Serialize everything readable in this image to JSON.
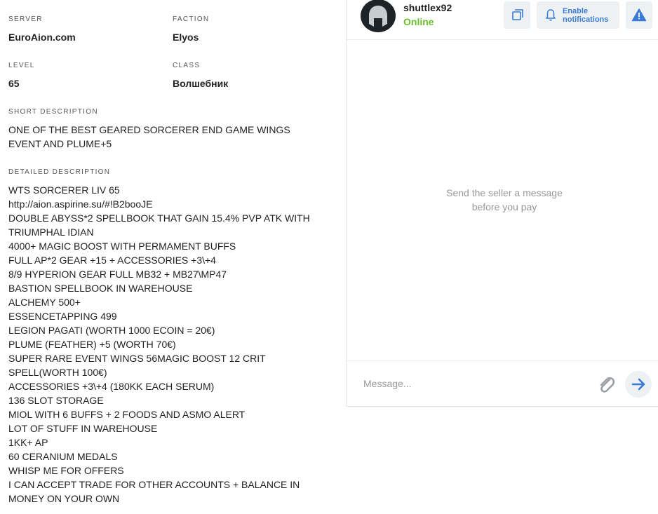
{
  "listing": {
    "server": {
      "label": "SERVER",
      "value": "EuroAion.com"
    },
    "faction": {
      "label": "FACTION",
      "value": "Elyos"
    },
    "level": {
      "label": "LEVEL",
      "value": "65"
    },
    "class": {
      "label": "CLASS",
      "value": "Волшебник"
    },
    "short_description": {
      "label": "SHORT DESCRIPTION",
      "lines": [
        "ONE OF THE BEST GEARED SORCERER END GAME WINGS",
        "EVENT AND PLUME+5"
      ]
    },
    "detailed_description": {
      "label": "DETAILED DESCRIPTION",
      "lines": [
        "WTS SORCERER LIV 65",
        "http://aion.aspirine.su/#!B2booJE",
        "DOUBLE ABYSS*2 SPELLBOOK THAT GAIN 15.4% PVP ATK WITH",
        "TRIUMPHAL IDIAN",
        "4000+ MAGIC BOOST WITH PERMAMENT BUFFS",
        "FULL AP*2 GEAR +15 + ACCESSORIES +3\\+4",
        "8/9 HYPERION GEAR FULL MB32 + MB27\\MP47",
        "BASTION SPELLBOOK IN WAREHOUSE",
        "ALCHEMY 500+",
        "ESSENCETAPPING 499",
        "LEGION PAGATI (WORTH 1000 ECOIN = 20€)",
        "PLUME (FEATHER) +5 (WORTH 70€)",
        "SUPER RARE EVENT WINGS 56MAGIC BOOST 12 CRIT",
        "SPELL(WORTH 100€)",
        "ACCESSORIES +3\\+4 (180KK EACH SERUM)",
        "136 SLOT STORAGE",
        "MIOL WITH 6 BUFFS + 2 FOODS AND ASMO ALERT",
        "LOT OF STUFF IN WAREHOUSE",
        "1KK+ AP",
        "60 CERANIUM MEDALS",
        "WHISP ME FOR OFFERS",
        "I CAN ACCEPT TRADE FOR OTHER ACCOUNTS + BALANCE IN",
        "MONEY ON YOUR OWN"
      ]
    }
  },
  "chat": {
    "username": "shuttlex92",
    "status": "Online",
    "status_color": "#6bbf2a",
    "accent_color": "#3a7bd5",
    "buttons": {
      "copy_icon": "copy-icon",
      "notify_icon": "bell-icon",
      "notify_label_line1": "Enable",
      "notify_label_line2": "notifications",
      "report_icon": "warning-icon"
    },
    "empty_line1": "Send the seller a message",
    "empty_line2": "before you pay",
    "input_placeholder": "Message...",
    "attach_icon": "paperclip-icon",
    "send_icon": "arrow-right-icon"
  }
}
